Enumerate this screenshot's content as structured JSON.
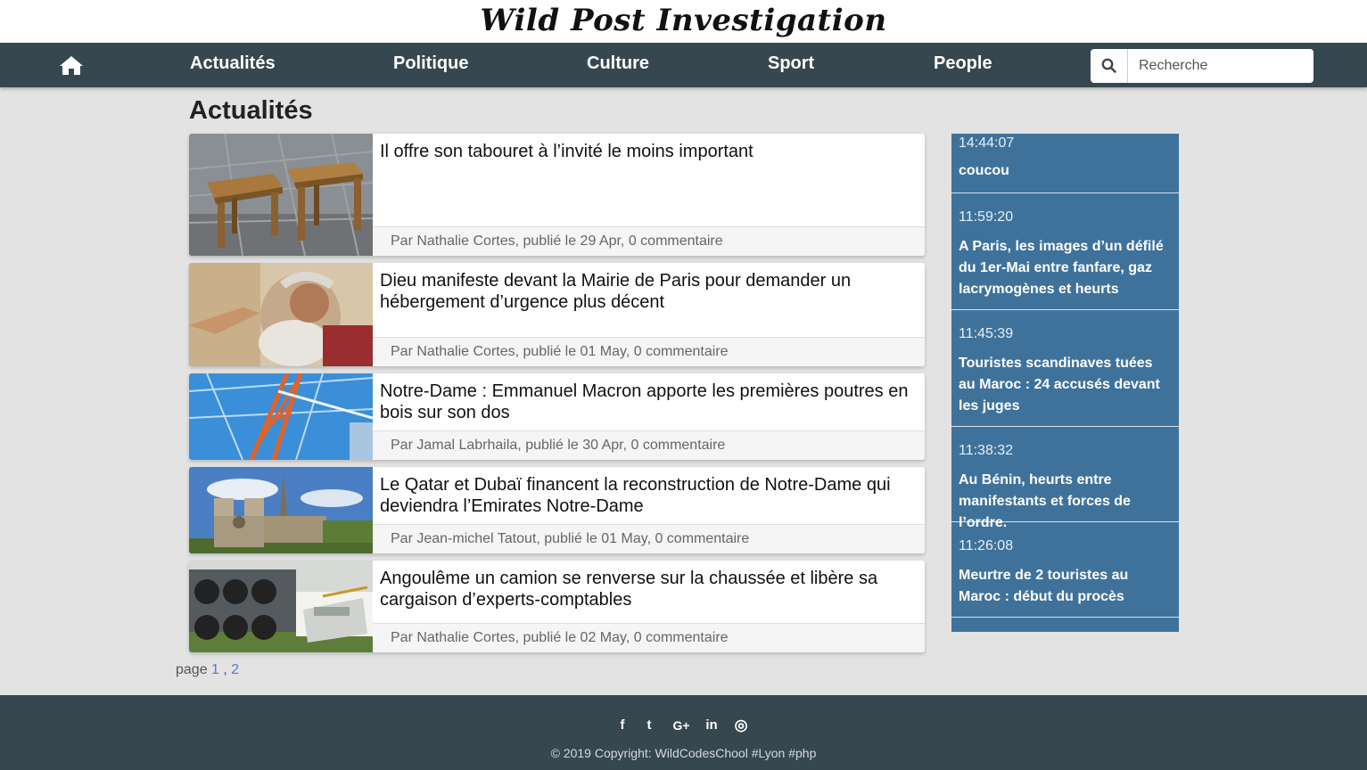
{
  "site": {
    "title": "Wild Post Investigation"
  },
  "nav": {
    "home_icon": "home-icon",
    "items": [
      {
        "label": "Actualités"
      },
      {
        "label": "Politique"
      },
      {
        "label": "Culture"
      },
      {
        "label": "Sport"
      },
      {
        "label": "People"
      }
    ],
    "search": {
      "icon": "search-icon",
      "placeholder": "Recherche",
      "value": ""
    }
  },
  "main": {
    "title": "Actualités",
    "articles": [
      {
        "title": "Il offre son tabouret à l’invité le moins important",
        "meta": "Par Nathalie Cortes, publié le 29 Apr, 0 commentaire",
        "image": "wooden-stools-photo"
      },
      {
        "title": "Dieu manifeste devant la Mairie de Paris pour demander un hébergement d’urgence plus décent",
        "meta": "Par Nathalie Cortes, publié le 01 May, 0 commentaire",
        "image": "god-fresco-photo"
      },
      {
        "title": "Notre-Dame : Emmanuel Macron apporte les premières poutres en bois sur son dos",
        "meta": "Par Jamal Labrhaila, publié le 30 Apr, 0 commentaire",
        "image": "construction-crane-photo"
      },
      {
        "title": "Le Qatar et Dubaï financent la reconstruction de Notre-Dame qui deviendra l’Emirates Notre-Dame",
        "meta": "Par Jean-michel Tatout, publié le 01 May, 0 commentaire",
        "image": "notre-dame-photo"
      },
      {
        "title": "Angoulême un camion se renverse sur la chaussée et libère sa cargaison d’experts-comptables",
        "meta": "Par Nathalie Cortes, publié le 02 May, 0 commentaire",
        "image": "overturned-truck-calculator-photo"
      }
    ],
    "pagination": {
      "label": "page",
      "pages": [
        "1",
        "2"
      ],
      "separator": " , "
    }
  },
  "ticker": {
    "items": [
      {
        "time": "14:44:07",
        "text": "coucou"
      },
      {
        "time": "11:59:20",
        "text": "A Paris, les images d’un défilé du 1er-Mai entre fanfare, gaz lacrymogènes et heurts"
      },
      {
        "time": "11:45:39",
        "text": "Touristes scandinaves tuées au Maroc : 24 accusés devant les juges"
      },
      {
        "time": "11:38:32",
        "text": "Au Bénin, heurts entre manifestants et forces de l’ordre."
      },
      {
        "time": "11:26:08",
        "text": "Meurtre de 2 touristes au Maroc : début du procès"
      }
    ]
  },
  "footer": {
    "social": [
      {
        "icon": "facebook-icon",
        "glyph": "f"
      },
      {
        "icon": "twitter-icon",
        "glyph": "t"
      },
      {
        "icon": "google-plus-icon",
        "glyph": "G+"
      },
      {
        "icon": "linkedin-icon",
        "glyph": "in"
      },
      {
        "icon": "dribbble-icon",
        "glyph": "◎"
      }
    ],
    "copyright": "© 2019 Copyright: WildCodesChool #Lyon #php"
  },
  "colors": {
    "navbar": "#37474f",
    "ticker": "#3f729b",
    "link": "#4f7bd8",
    "background": "#e3e3e3"
  }
}
